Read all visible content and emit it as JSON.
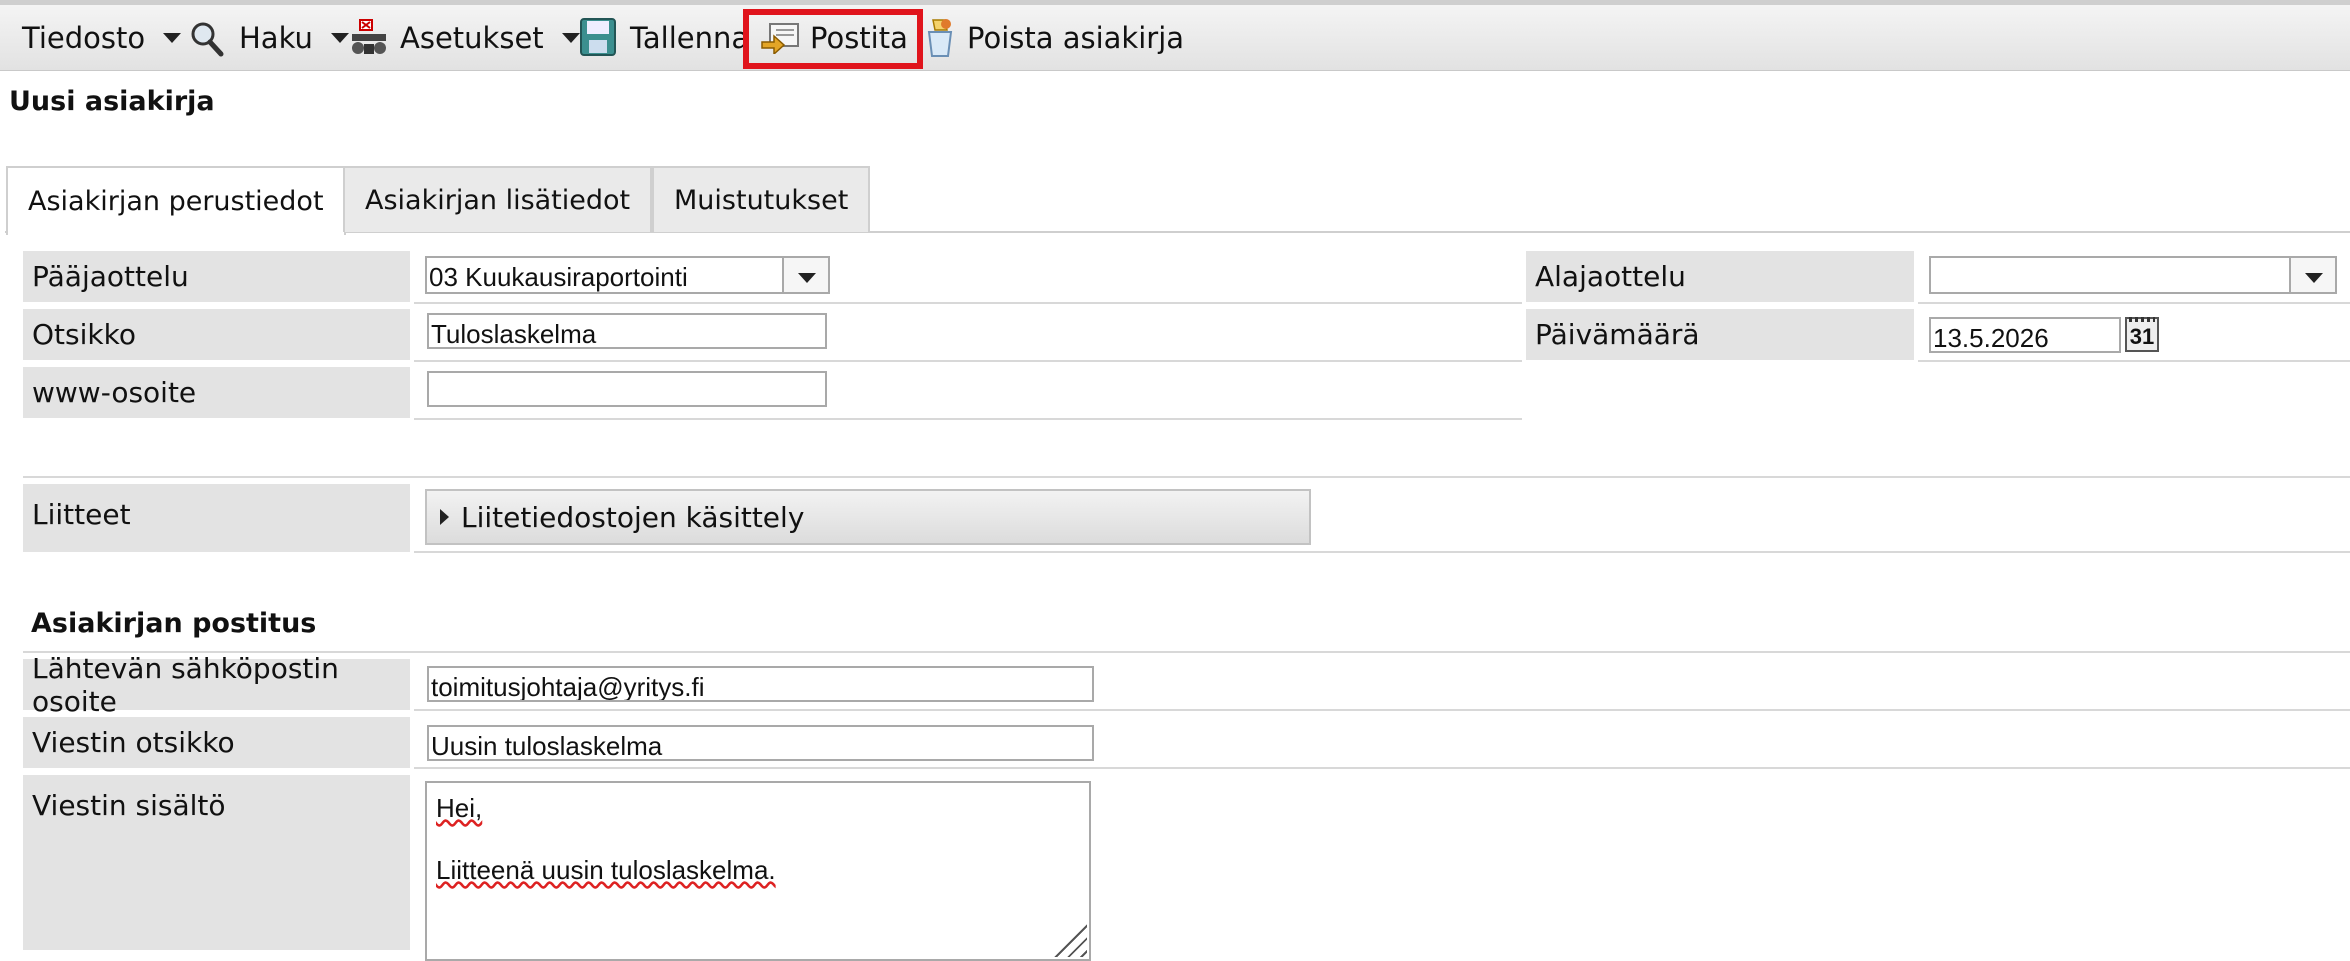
{
  "toolbar": {
    "file": "Tiedosto",
    "search": "Haku",
    "settings": "Asetukset",
    "save": "Tallenna",
    "post": "Postita",
    "delete": "Poista asiakirja"
  },
  "page_title": "Uusi asiakirja",
  "tabs": [
    "Asiakirjan perustiedot",
    "Asiakirjan lisätiedot",
    "Muistutukset"
  ],
  "form": {
    "main_section_label": "Pääjaottelu",
    "main_section_value": "03 Kuukausiraportointi",
    "sub_section_label": "Alajaottelu",
    "sub_section_value": "",
    "title_label": "Otsikko",
    "title_value": "Tuloslaskelma",
    "date_label": "Päivämäärä",
    "date_value": "13.5.2026",
    "calendar_day": "31",
    "www_label": "www-osoite",
    "www_value": "",
    "attachments_label": "Liitteet",
    "attachments_button": "Liitetiedostojen käsittely"
  },
  "mailing": {
    "section_title": "Asiakirjan postitus",
    "sender_label": "Lähtevän sähköpostin osoite",
    "sender_value": "toimitusjohtaja@yritys.fi",
    "subject_label": "Viestin otsikko",
    "subject_value": "Uusin tuloslaskelma",
    "body_label": "Viestin sisältö",
    "body_line1": "Hei,",
    "body_line2": "Liitteenä uusin tuloslaskelma."
  },
  "colors": {
    "highlight": "#e0141c",
    "label_bg": "#e3e3e3"
  }
}
